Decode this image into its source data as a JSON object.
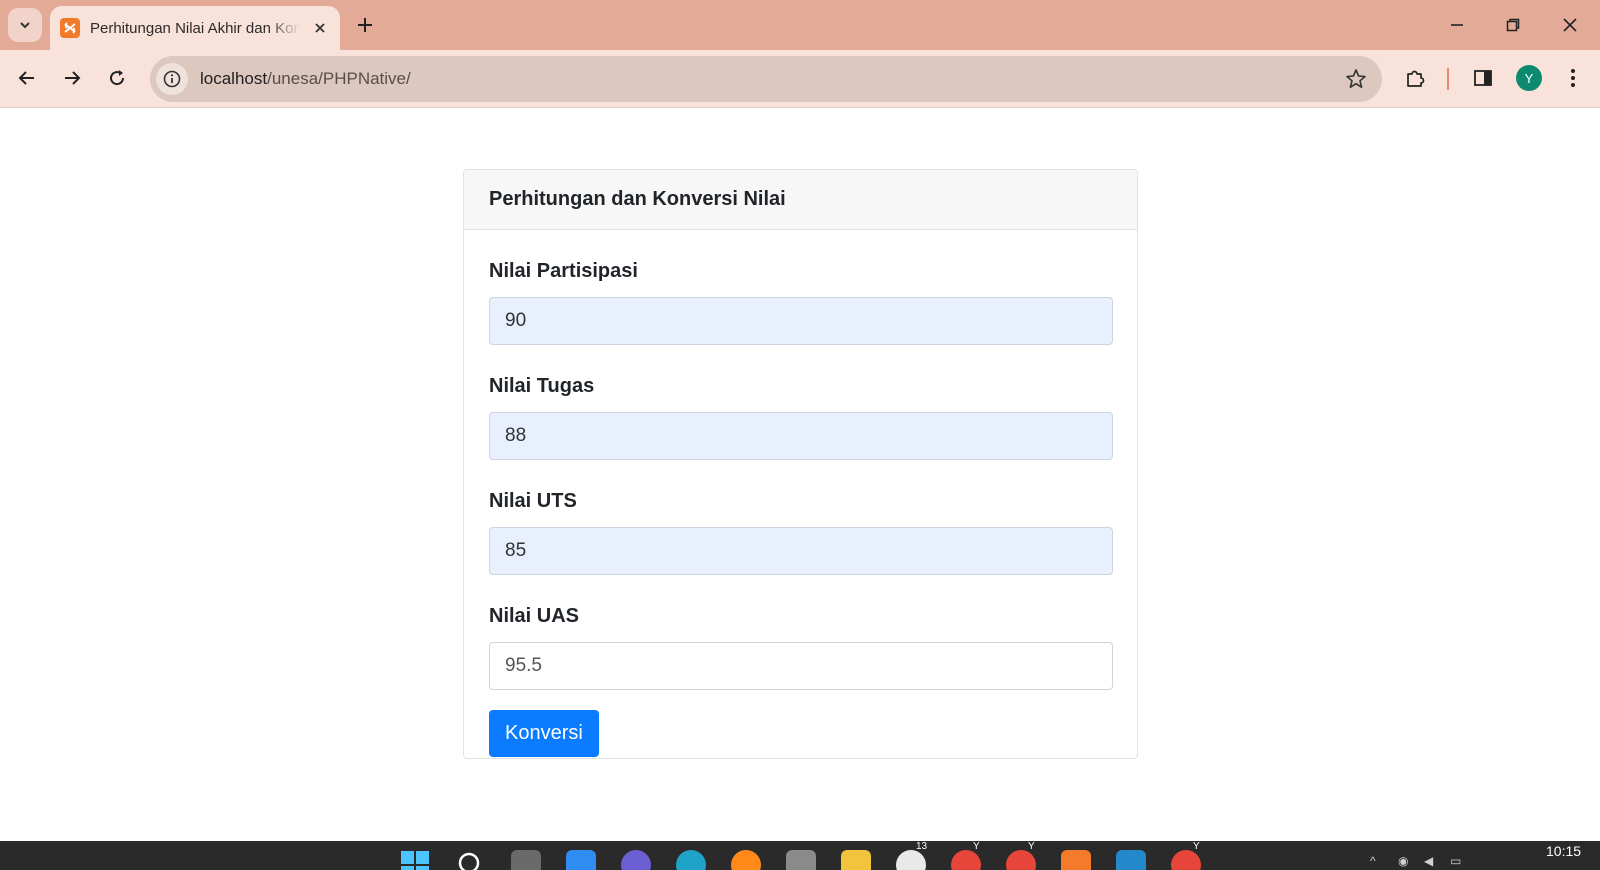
{
  "browser": {
    "tab_title": "Perhitungan Nilai Akhir dan Konversi Nilai",
    "url_host": "localhost",
    "url_path": "/unesa/PHPNative/",
    "profile_initial": "Y"
  },
  "page": {
    "card_title": "Perhitungan dan Konversi Nilai",
    "fields": [
      {
        "label": "Nilai Partisipasi",
        "value": "90"
      },
      {
        "label": "Nilai Tugas",
        "value": "88"
      },
      {
        "label": "Nilai UTS",
        "value": "85"
      },
      {
        "label": "Nilai UAS",
        "value": "95.5"
      }
    ],
    "submit_label": "Konversi"
  },
  "taskbar": {
    "whatsapp_badge": "13",
    "chrome_profile_1": "Y",
    "chrome_profile_2": "Y",
    "chrome_profile_3": "Y",
    "clock": "10:15"
  },
  "colors": {
    "tab_strip": "#e3aa98",
    "toolbar": "#f8e2da",
    "autofill_input": "#e8f0fe",
    "primary_button": "#0b7bff",
    "taskbar": "#2a2a2a"
  }
}
